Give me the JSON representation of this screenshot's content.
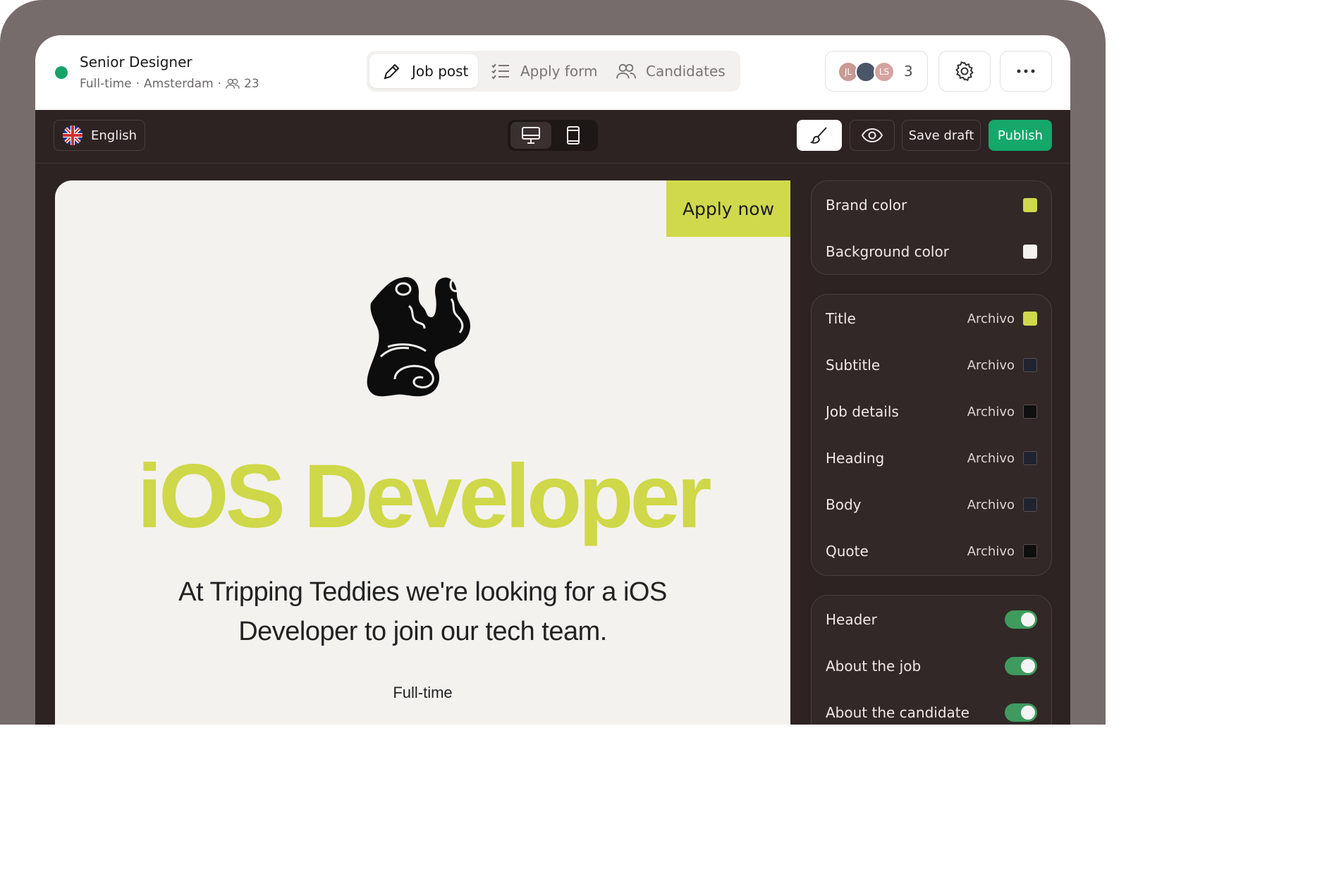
{
  "header": {
    "job_title": "Senior Designer",
    "job_type": "Full-time",
    "location": "Amsterdam",
    "separator": "·",
    "applicant_count": "23",
    "status_color": "#16a36a"
  },
  "tabs": [
    {
      "label": "Job post",
      "icon": "pencil-icon",
      "active": true
    },
    {
      "label": "Apply form",
      "icon": "checklist-icon",
      "active": false
    },
    {
      "label": "Candidates",
      "icon": "users-icon",
      "active": false
    }
  ],
  "collaborators": {
    "avatars": [
      {
        "initials": "JL"
      },
      {
        "initials": ""
      },
      {
        "initials": "LS"
      }
    ],
    "count": "3"
  },
  "toolbar": {
    "language": "English",
    "save_label": "Save draft",
    "publish_label": "Publish",
    "publish_color": "#15a86a"
  },
  "preview": {
    "apply_label": "Apply now",
    "title": "iOS Developer",
    "subtitle": "At Tripping Teddies we're looking for a iOS Developer to join our tech team.",
    "job_type": "Full-time",
    "brand_color": "#d0d94b",
    "background_color": "#f3f2ef"
  },
  "colors_panel": [
    {
      "label": "Brand color",
      "swatch": "#d0d94b"
    },
    {
      "label": "Background color",
      "swatch": "#f3f2ef"
    }
  ],
  "fonts_panel": [
    {
      "label": "Title",
      "font": "Archivo",
      "swatch": "#d0d94b"
    },
    {
      "label": "Subtitle",
      "font": "Archivo",
      "swatch": "#1f2430"
    },
    {
      "label": "Job details",
      "font": "Archivo",
      "swatch": "#0f0f0f"
    },
    {
      "label": "Heading",
      "font": "Archivo",
      "swatch": "#1f2430"
    },
    {
      "label": "Body",
      "font": "Archivo",
      "swatch": "#1f2430"
    },
    {
      "label": "Quote",
      "font": "Archivo",
      "swatch": "#0f0f0f"
    }
  ],
  "sections_panel": [
    {
      "label": "Header",
      "enabled": true
    },
    {
      "label": "About the job",
      "enabled": true
    },
    {
      "label": "About the candidate",
      "enabled": true
    }
  ]
}
